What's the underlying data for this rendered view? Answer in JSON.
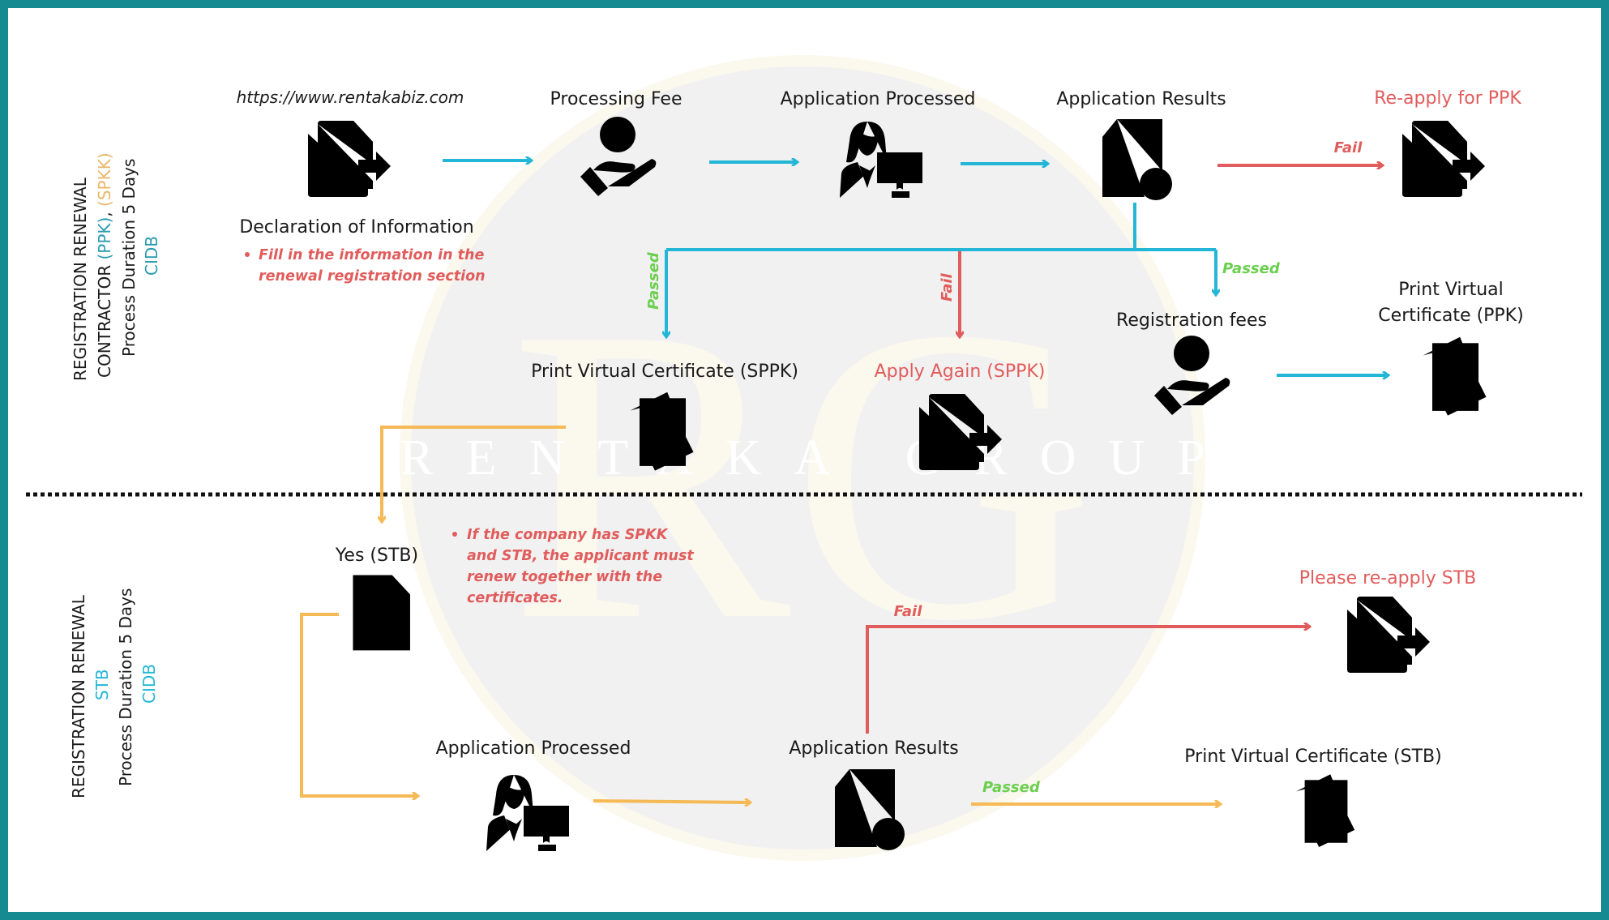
{
  "colors": {
    "frame": "#168a91",
    "flow_ppk": "#23b6d6",
    "flow_stb": "#f5b955",
    "fail": "#e15c5c",
    "passed": "#6ccf4f",
    "highlight_ppk": "#2a9bb0",
    "highlight_spkk": "#e8b86a"
  },
  "watermark": {
    "monogram": "RG",
    "text": "RENTAKA GROUP"
  },
  "section_ppk": {
    "side_label": {
      "line1": "REGISTRATION RENEWAL",
      "line2_prefix": "CONTRACTOR ",
      "line2_ppk": "(PPK)",
      "line2_sep": ", ",
      "line2_spkk": "(SPKK)",
      "line3": "Process Duration 5 Days",
      "line4": "CIDB"
    },
    "nodes": {
      "website": {
        "url": "https://www.rentakabiz.com",
        "label": "Declaration of Information",
        "icon": "document-export-icon",
        "note": [
          "Fill in the information in the",
          "renewal registration section"
        ]
      },
      "processing_fee": {
        "label": "Processing Fee",
        "icon": "hand-money-icon"
      },
      "application_processed": {
        "label": "Application Processed",
        "icon": "officer-computer-icon"
      },
      "application_results": {
        "label": "Application Results",
        "icon": "document-check-icon"
      },
      "reapply_ppk": {
        "label": "Re-apply for PPK",
        "icon": "document-export-icon"
      },
      "print_sppk": {
        "label": "Print Virtual Certificate (SPPK)",
        "icon": "certificate-icon"
      },
      "apply_again_sppk": {
        "label": "Apply Again (SPPK)",
        "icon": "document-export-icon"
      },
      "registration_fees": {
        "label": "Registration fees",
        "icon": "hand-money-icon"
      },
      "print_ppk": {
        "label_line1": "Print Virtual",
        "label_line2": "Certificate (PPK)",
        "icon": "certificate-icon"
      }
    },
    "edges": {
      "fail_to_reapply": "Fail",
      "passed_to_sppk": "Passed",
      "fail_to_apply_again": "Fail",
      "passed_to_registration": "Passed"
    }
  },
  "section_stb": {
    "side_label": {
      "line1": "REGISTRATION RENEWAL",
      "line2": "STB",
      "line3": "Process Duration 5 Days",
      "line4": "CIDB"
    },
    "nodes": {
      "yes_stb": {
        "label": "Yes (STB)",
        "icon": "document-icon",
        "note": [
          "If the company has SPKK",
          "and STB, the applicant must",
          "renew together with the",
          "certificates."
        ]
      },
      "application_processed": {
        "label": "Application Processed",
        "icon": "officer-computer-icon"
      },
      "application_results": {
        "label": "Application Results",
        "icon": "document-check-icon"
      },
      "reapply_stb": {
        "label": "Please re-apply STB",
        "icon": "document-export-icon"
      },
      "print_stb": {
        "label": "Print Virtual Certificate (STB)",
        "icon": "certificate-icon"
      }
    },
    "edges": {
      "fail_to_reapply": "Fail",
      "passed_to_print": "Passed"
    }
  }
}
